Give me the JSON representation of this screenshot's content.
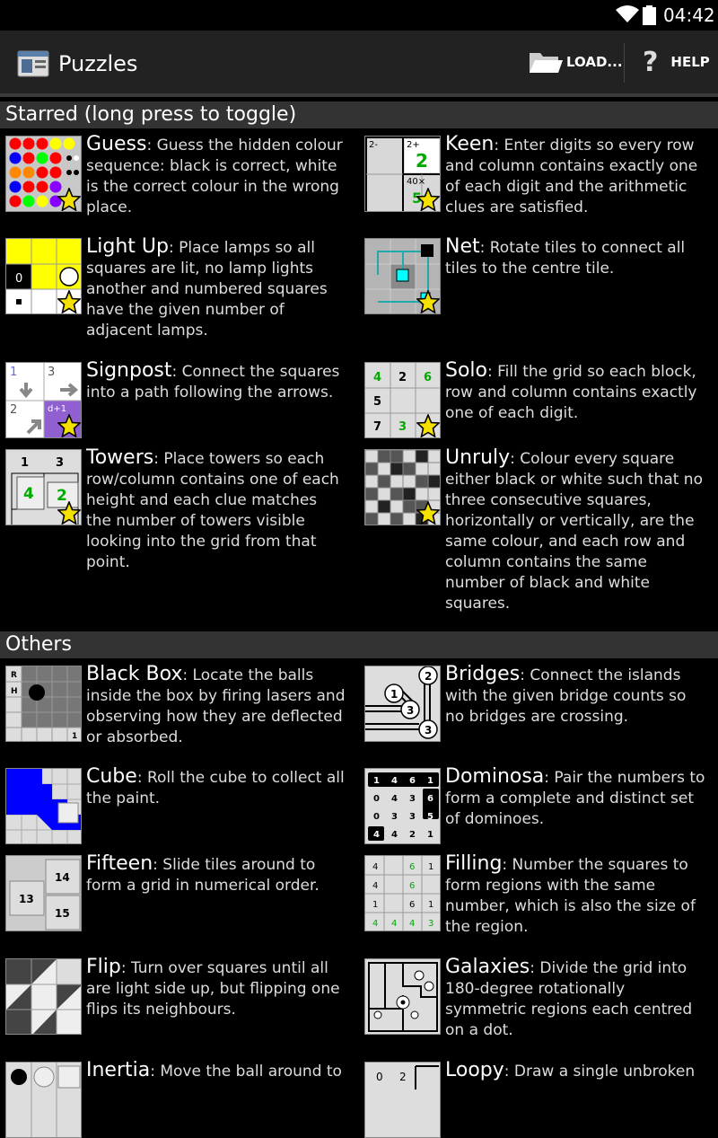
{
  "status": {
    "time": "04:42"
  },
  "actionbar": {
    "title": "Puzzles",
    "load_label": "LOAD...",
    "help_label": "HELP",
    "help_glyph": "?"
  },
  "sections": [
    {
      "header": "Starred (long press to toggle)",
      "items": [
        {
          "name": "Guess",
          "desc": ": Guess the hidden colour sequence: black is correct, white is the correct colour in the wrong place.",
          "icon": "guess-thumbnail",
          "starred": true
        },
        {
          "name": "Keen",
          "desc": ": Enter digits so every row and column contains exactly one of each digit and the arithmetic clues are satisfied.",
          "icon": "keen-thumbnail",
          "starred": true
        },
        {
          "name": "Light Up",
          "desc": ": Place lamps so all squares are lit, no lamp lights another and numbered squares have the given number of adjacent lamps.",
          "icon": "lightup-thumbnail",
          "starred": true
        },
        {
          "name": "Net",
          "desc": ": Rotate tiles to connect all tiles to the centre tile.",
          "icon": "net-thumbnail",
          "starred": true
        },
        {
          "name": "Signpost",
          "desc": ": Connect the squares into a path following the arrows.",
          "icon": "signpost-thumbnail",
          "starred": true
        },
        {
          "name": "Solo",
          "desc": ": Fill the grid so each block, row and column contains exactly one of each digit.",
          "icon": "solo-thumbnail",
          "starred": true
        },
        {
          "name": "Towers",
          "desc": ": Place towers so each row/column contains one of each height and each clue matches the number of towers visible looking into the grid from that point.",
          "icon": "towers-thumbnail",
          "starred": true
        },
        {
          "name": "Unruly",
          "desc": ": Colour every square either black or white such that no three consecutive squares, horizontally or vertically, are the same colour, and each row and column contains the same number of black and white squares.",
          "icon": "unruly-thumbnail",
          "starred": true
        }
      ]
    },
    {
      "header": "Others",
      "items": [
        {
          "name": "Black Box",
          "desc": ": Locate the balls inside the box by firing lasers and observing how they are deflected or absorbed.",
          "icon": "blackbox-thumbnail",
          "starred": false
        },
        {
          "name": "Bridges",
          "desc": ": Connect the islands with the given bridge counts so no bridges are crossing.",
          "icon": "bridges-thumbnail",
          "starred": false
        },
        {
          "name": "Cube",
          "desc": ": Roll the cube to collect all the paint.",
          "icon": "cube-thumbnail",
          "starred": false
        },
        {
          "name": "Dominosa",
          "desc": ": Pair the numbers to form a complete and distinct set of dominoes.",
          "icon": "dominosa-thumbnail",
          "starred": false
        },
        {
          "name": "Fifteen",
          "desc": ": Slide tiles around to form a grid in numerical order.",
          "icon": "fifteen-thumbnail",
          "starred": false
        },
        {
          "name": "Filling",
          "desc": ": Number the squares to form regions with the same number, which is also the size of the region.",
          "icon": "filling-thumbnail",
          "starred": false
        },
        {
          "name": "Flip",
          "desc": ": Turn over squares until all are light side up, but flipping one flips its neighbours.",
          "icon": "flip-thumbnail",
          "starred": false
        },
        {
          "name": "Galaxies",
          "desc": ": Divide the grid into 180-degree rotationally symmetric regions each centred on a dot.",
          "icon": "galaxies-thumbnail",
          "starred": false
        },
        {
          "name": "Inertia",
          "desc": ": Move the ball around to",
          "icon": "inertia-thumbnail",
          "starred": false
        },
        {
          "name": "Loopy",
          "desc": ": Draw a single unbroken",
          "icon": "loopy-thumbnail",
          "starred": false
        }
      ]
    }
  ],
  "thumb_text": {
    "keen": [
      "2-",
      "2+",
      "2",
      "40×",
      "5"
    ],
    "lightup": [
      "0"
    ],
    "signpost": [
      "1",
      "3",
      "2",
      "d+1"
    ],
    "solo": [
      "4",
      "2",
      "6",
      "5",
      "7",
      "3"
    ],
    "towers": [
      "1",
      "3",
      "4",
      "2"
    ],
    "blackbox": [
      "R",
      "H",
      "1"
    ],
    "bridges": [
      "1",
      "2",
      "3",
      "3"
    ],
    "dominosa": [
      [
        "1",
        "4",
        "6",
        "1"
      ],
      [
        "0",
        "4",
        "3",
        "6"
      ],
      [
        "0",
        "3",
        "3",
        "5"
      ],
      [
        "4",
        "4",
        "2",
        "1"
      ]
    ],
    "fifteen": [
      "14",
      "13",
      "15"
    ],
    "filling": [
      [
        "4",
        "",
        "6",
        "1"
      ],
      [
        "4",
        "",
        "6",
        ""
      ],
      [
        "1",
        "",
        "6",
        "1"
      ],
      [
        "4",
        "4",
        "4",
        "3"
      ]
    ],
    "inertia": [],
    "loopy": [
      "0",
      "2"
    ]
  },
  "colors": {
    "accent_star": "#f5e100",
    "header_bg": "#333333",
    "actionbar_bg": "#222222"
  }
}
